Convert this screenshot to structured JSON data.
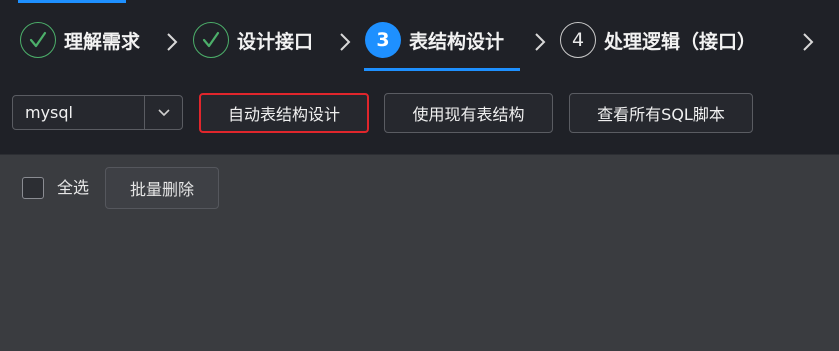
{
  "steps": [
    {
      "number": "1",
      "label": "理解需求",
      "state": "done"
    },
    {
      "number": "2",
      "label": "设计接口",
      "state": "done"
    },
    {
      "number": "3",
      "label": "表结构设计",
      "state": "current"
    },
    {
      "number": "4",
      "label": "处理逻辑（接口）",
      "state": "todo"
    }
  ],
  "toolbar": {
    "db_select_value": "mysql",
    "auto_design_label": "自动表结构设计",
    "use_existing_label": "使用现有表结构",
    "view_sql_label": "查看所有SQL脚本"
  },
  "list": {
    "select_all_label": "全选",
    "batch_delete_label": "批量删除"
  },
  "colors": {
    "accent": "#1e90ff",
    "done": "#4caf6a",
    "highlight_border": "#e0262c",
    "header_bg": "#1f2127",
    "content_bg": "#3a3c40"
  }
}
